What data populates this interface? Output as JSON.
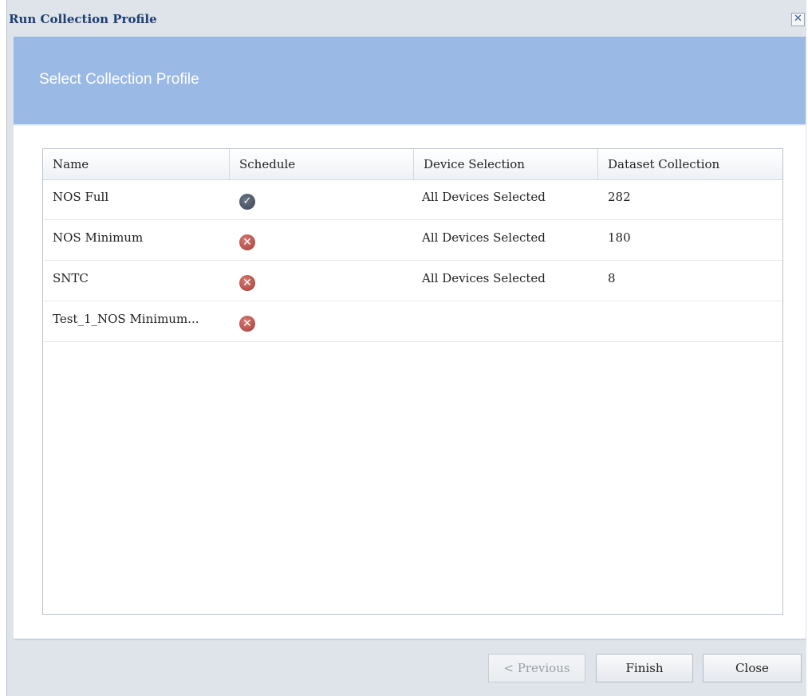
{
  "window": {
    "title": "Run Collection Profile",
    "close_glyph": "✕"
  },
  "banner": {
    "title": "Select Collection Profile"
  },
  "table": {
    "columns": [
      "Name",
      "Schedule",
      "Device Selection",
      "Dataset Collection"
    ],
    "rows": [
      {
        "name": "NOS Full",
        "schedule": "enabled",
        "schedule_icon": "check-icon",
        "device_selection": "All Devices Selected",
        "dataset_collection": "282"
      },
      {
        "name": "NOS Minimum",
        "schedule": "disabled",
        "schedule_icon": "x-icon",
        "device_selection": "All Devices Selected",
        "dataset_collection": "180"
      },
      {
        "name": "SNTC",
        "schedule": "disabled",
        "schedule_icon": "x-icon",
        "device_selection": "All Devices Selected",
        "dataset_collection": "8"
      },
      {
        "name": "Test_1_NOS Minimum...",
        "schedule": "disabled",
        "schedule_icon": "x-icon",
        "device_selection": "",
        "dataset_collection": ""
      }
    ]
  },
  "footer": {
    "previous_label": "< Previous",
    "finish_label": "Finish",
    "close_label": "Close"
  },
  "colors": {
    "banner": "#9ab9e5",
    "title_text": "#1f3f74",
    "check_icon": "#4a5462",
    "x_icon": "#b5463e"
  }
}
